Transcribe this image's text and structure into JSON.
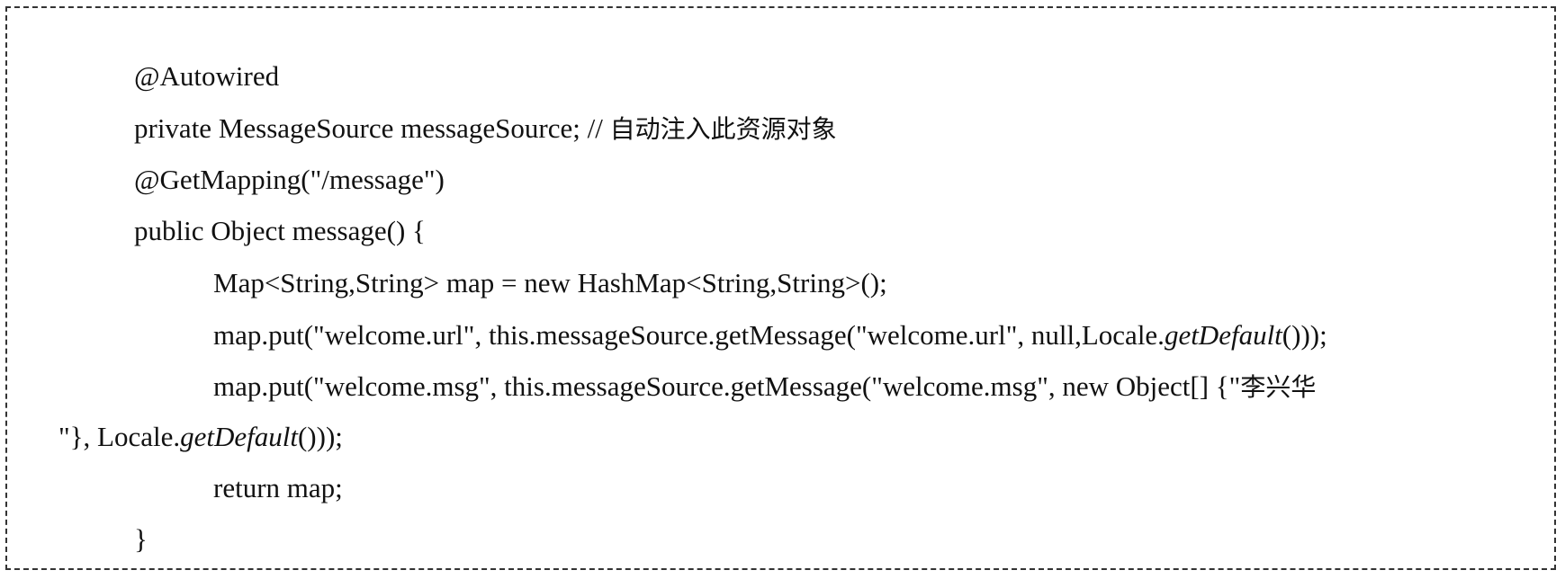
{
  "code": {
    "line1": "@Autowired",
    "line2_code": "private MessageSource messageSource; // ",
    "line2_comment": "自动注入此资源对象",
    "line3": "@GetMapping(\"/message\")",
    "line4": "public Object message() {",
    "line5": "Map<String,String> map = new HashMap<String,String>();",
    "line6_a": "map.put(\"welcome.url\", this.messageSource.getMessage(\"welcome.url\", null,Locale.",
    "line6_italic": "getDefault",
    "line6_b": "()));",
    "line7_a": "map.put(\"welcome.msg\", this.messageSource.getMessage(\"welcome.msg\", new Object[] {\"",
    "line7_cjk": "李兴华",
    "line8_a": "\"}, Locale.",
    "line8_italic": "getDefault",
    "line8_b": "()));",
    "line9": "return map;",
    "line10": "}"
  }
}
